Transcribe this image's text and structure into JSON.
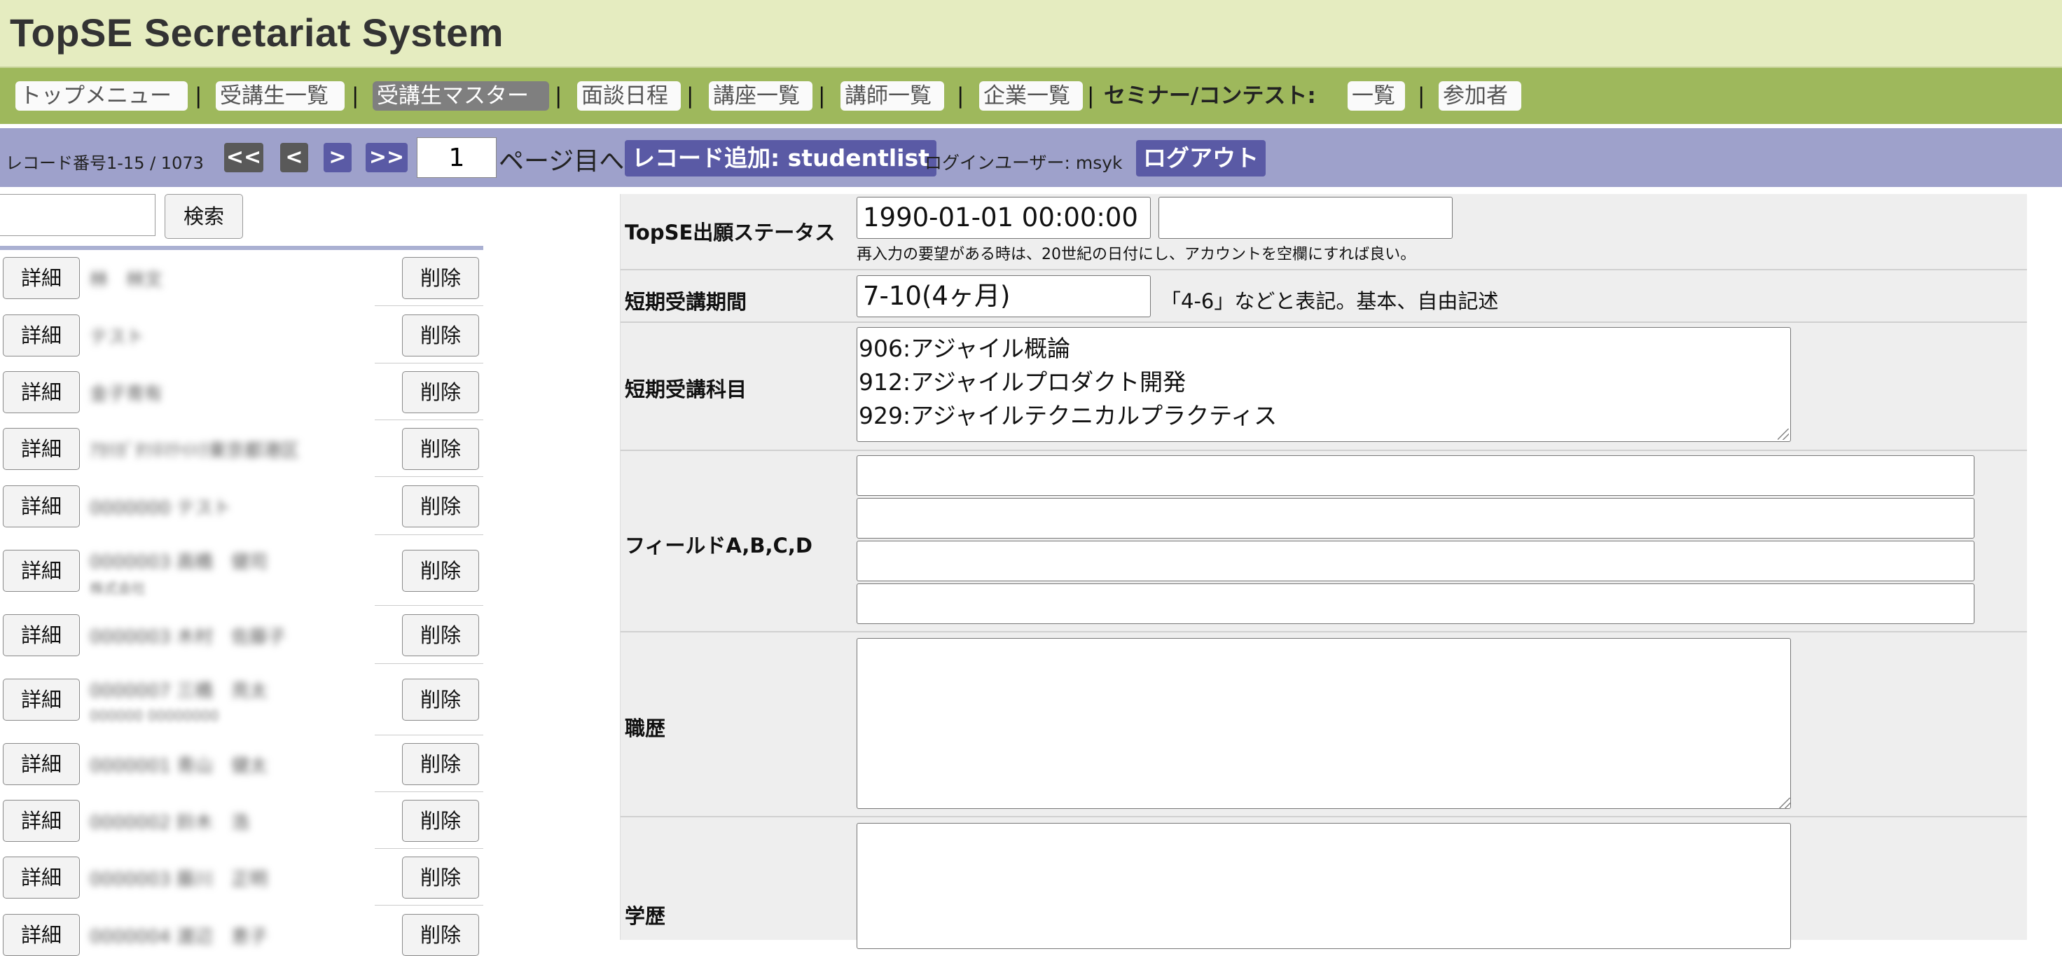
{
  "app": {
    "title": "TopSE Secretariat System"
  },
  "nav": {
    "top_menu": "トップメニュー",
    "student_list": "受講生一覧",
    "student_master": "受講生マスター",
    "interview_schedule": "面談日程",
    "course_list": "講座一覧",
    "lecturer_list": "講師一覧",
    "company_list": "企業一覧",
    "seminar_label": "セミナー/コンテスト:",
    "seminar_list": "一覧",
    "participants": "参加者",
    "separator": "|"
  },
  "record_bar": {
    "record_range": "レコード番号1-15 / 1073",
    "first": "<<",
    "prev": "<",
    "next": ">",
    "last": ">>",
    "page_value": "1",
    "page_suffix": "ページ目へ",
    "add_record": "レコード追加: studentlist",
    "login_user": "ログインユーザー: msyk",
    "logout": "ログアウト"
  },
  "search": {
    "input_value": "",
    "button_label": "検索"
  },
  "list": {
    "detail_label": "詳細",
    "delete_label": "削除",
    "rows": [
      {
        "name": "林　林文",
        "sub": ""
      },
      {
        "name": "テスト",
        "sub": ""
      },
      {
        "name": "金子育有",
        "sub": ""
      },
      {
        "name": "ｱｶﾘｶﾞﾀﾂﾈﾏﾃｲﾊﾗ東京都港区",
        "sub": ""
      },
      {
        "name": "0000000 テスト",
        "sub": ""
      },
      {
        "name": "0000003 高橋　健司",
        "sub": "株式会社"
      },
      {
        "name": "0000003 木村　佐藤子",
        "sub": ""
      },
      {
        "name": "0000007 三橋　亮太",
        "sub": "000000 00000000"
      },
      {
        "name": "0000001 青山　健太",
        "sub": ""
      },
      {
        "name": "0000002 鈴木　浩",
        "sub": ""
      },
      {
        "name": "0000003 藤川　正明",
        "sub": ""
      },
      {
        "name": "0000004 渡辺　恵子",
        "sub": ""
      }
    ]
  },
  "form": {
    "status": {
      "label": "TopSE出願ステータス",
      "value1": "1990-01-01 00:00:00",
      "value2": "",
      "note": "再入力の要望がある時は、20世紀の日付にし、アカウントを空欄にすれば良い。"
    },
    "period": {
      "label": "短期受講期間",
      "value": "7-10(4ヶ月)",
      "note": "「4-6」などと表記。基本、自由記述"
    },
    "subjects": {
      "label": "短期受講科目",
      "lines": [
        "906:アジャイル概論",
        "912:アジャイルプロダクト開発",
        "929:アジャイルテクニカルプラクティス"
      ]
    },
    "fields": {
      "label": "フィールドA,B,C,D",
      "values": [
        "",
        "",
        "",
        ""
      ]
    },
    "career": {
      "label": "職歴",
      "value": ""
    },
    "education": {
      "label": "学歴",
      "value": ""
    }
  },
  "colors": {
    "title_bg": "#e5ecc0",
    "nav_bg": "#9eb85c",
    "record_bar_bg": "#9ea1cb",
    "accent_purple": "#5a5aa5",
    "form_bg": "#eeeeee"
  }
}
